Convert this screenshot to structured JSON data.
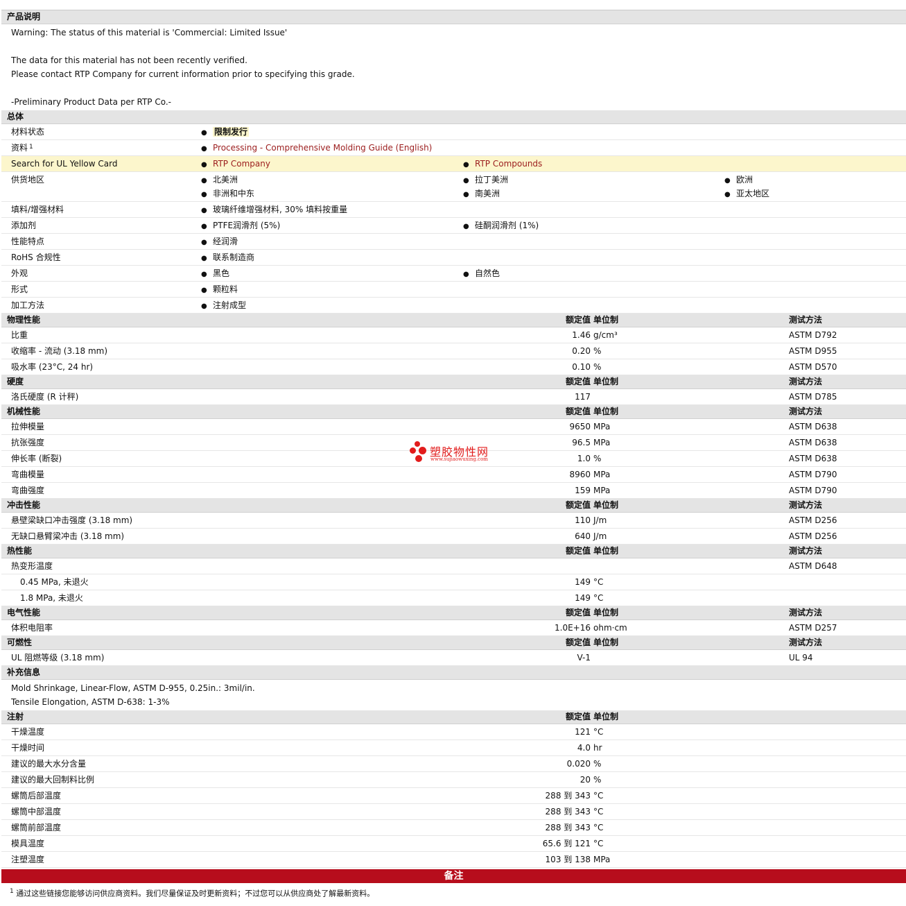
{
  "headers": {
    "value": "额定值",
    "unit": "单位制",
    "method": "测试方法"
  },
  "description": {
    "title": "产品说明",
    "lines": [
      "Warning: The status of this material is 'Commercial: Limited Issue'",
      "",
      "The data for this material has not been recently verified.",
      "Please contact RTP Company for current information prior to specifying this grade.",
      "",
      "-Preliminary Product Data per RTP Co.-"
    ]
  },
  "general": {
    "title": "总体",
    "rows": [
      {
        "label": "材料状态",
        "items": [
          "限制发行"
        ]
      },
      {
        "label": "资料",
        "sup": "1",
        "items": [
          "Processing - Comprehensive Molding Guide (English)"
        ]
      },
      {
        "label": "Search for UL Yellow Card",
        "items": [
          "RTP Company",
          "RTP Compounds"
        ]
      },
      {
        "label": "供货地区",
        "items": [
          "北美洲",
          "拉丁美洲",
          "欧洲",
          "非洲和中东",
          "南美洲",
          "亚太地区"
        ]
      },
      {
        "label": "填料/增强材料",
        "items": [
          "玻璃纤维增强材料, 30% 填料按重量"
        ]
      },
      {
        "label": "添加剂",
        "items": [
          "PTFE润滑剂 (5%)",
          "硅酮润滑剂 (1%)"
        ]
      },
      {
        "label": "性能特点",
        "items": [
          "经润滑"
        ]
      },
      {
        "label": "RoHS 合规性",
        "items": [
          "联系制造商"
        ]
      },
      {
        "label": "外观",
        "items": [
          "黑色",
          "自然色"
        ]
      },
      {
        "label": "形式",
        "items": [
          "颗粒料"
        ]
      },
      {
        "label": "加工方法",
        "items": [
          "注射成型"
        ]
      }
    ]
  },
  "sections": [
    {
      "title": "物理性能",
      "rows": [
        {
          "label": "比重",
          "value": "1.46",
          "unit": "g/cm³",
          "method": "ASTM D792"
        },
        {
          "label": "收缩率 - 流动 (3.18 mm)",
          "value": "0.20",
          "unit": "%",
          "method": "ASTM D955"
        },
        {
          "label": "吸水率 (23°C, 24 hr)",
          "value": "0.10",
          "unit": "%",
          "method": "ASTM D570"
        }
      ]
    },
    {
      "title": "硬度",
      "rows": [
        {
          "label": "洛氏硬度 (R 计秤)",
          "value": "117",
          "unit": "",
          "method": "ASTM D785"
        }
      ]
    },
    {
      "title": "机械性能",
      "rows": [
        {
          "label": "拉伸模量",
          "value": "9650",
          "unit": "MPa",
          "method": "ASTM D638"
        },
        {
          "label": "抗张强度",
          "value": "96.5",
          "unit": "MPa",
          "method": "ASTM D638"
        },
        {
          "label": "伸长率 (断裂)",
          "value": "1.0",
          "unit": "%",
          "method": "ASTM D638"
        },
        {
          "label": "弯曲模量",
          "value": "8960",
          "unit": "MPa",
          "method": "ASTM D790"
        },
        {
          "label": "弯曲强度",
          "value": "159",
          "unit": "MPa",
          "method": "ASTM D790"
        }
      ]
    },
    {
      "title": "冲击性能",
      "rows": [
        {
          "label": "悬壁梁缺口冲击强度 (3.18 mm)",
          "value": "110",
          "unit": "J/m",
          "method": "ASTM D256"
        },
        {
          "label": "无缺口悬臂梁冲击 (3.18 mm)",
          "value": "640",
          "unit": "J/m",
          "method": "ASTM D256"
        }
      ]
    },
    {
      "title": "热性能",
      "rows": [
        {
          "label": "热变形温度",
          "value": "",
          "unit": "",
          "method": "ASTM D648"
        },
        {
          "label": "0.45 MPa, 未退火",
          "value": "149",
          "unit": "°C",
          "method": "",
          "sub": true
        },
        {
          "label": "1.8 MPa, 未退火",
          "value": "149",
          "unit": "°C",
          "method": "",
          "sub": true
        }
      ]
    },
    {
      "title": "电气性能",
      "rows": [
        {
          "label": "体积电阻率",
          "value": "1.0E+16",
          "unit": "ohm·cm",
          "method": "ASTM D257"
        }
      ]
    },
    {
      "title": "可燃性",
      "rows": [
        {
          "label": "UL 阻燃等级 (3.18 mm)",
          "value": "V-1",
          "unit": "",
          "method": "UL 94"
        }
      ]
    }
  ],
  "supplement": {
    "title": "补充信息",
    "lines": [
      "Mold Shrinkage, Linear-Flow, ASTM D-955, 0.25in.: 3mil/in.",
      "Tensile Elongation, ASTM D-638: 1-3%"
    ]
  },
  "injection": {
    "title": "注射",
    "rows": [
      {
        "label": "干燥温度",
        "value": "121",
        "unit": "°C"
      },
      {
        "label": "干燥时间",
        "value": "4.0",
        "unit": "hr"
      },
      {
        "label": "建议的最大水分含量",
        "value": "0.020",
        "unit": "%"
      },
      {
        "label": "建议的最大回制料比例",
        "value": "20",
        "unit": "%"
      },
      {
        "label": "螺筒后部温度",
        "value": "288 到 343",
        "unit": "°C"
      },
      {
        "label": "螺筒中部温度",
        "value": "288 到 343",
        "unit": "°C"
      },
      {
        "label": "螺筒前部温度",
        "value": "288 到 343",
        "unit": "°C"
      },
      {
        "label": "模具温度",
        "value": "65.6 到 121",
        "unit": "°C"
      },
      {
        "label": "注塑温度",
        "value": "103 到 138",
        "unit": "MPa"
      }
    ]
  },
  "notes": {
    "title": "备注",
    "footnote_mark": "1",
    "footnote": "通过这些链接您能够访问供应商资料。我们尽量保证及时更新资料；不过您可以从供应商处了解最新资料。"
  },
  "watermark": {
    "text": "塑胶物性网",
    "sub": "www.sujiaowuxing.com",
    "color": "#e21c1c"
  },
  "colors": {
    "section_bg": "#e4e4e4",
    "highlight": "#fcf6cc",
    "link": "#9b1c1c",
    "notes_bar": "#b70d1c"
  }
}
